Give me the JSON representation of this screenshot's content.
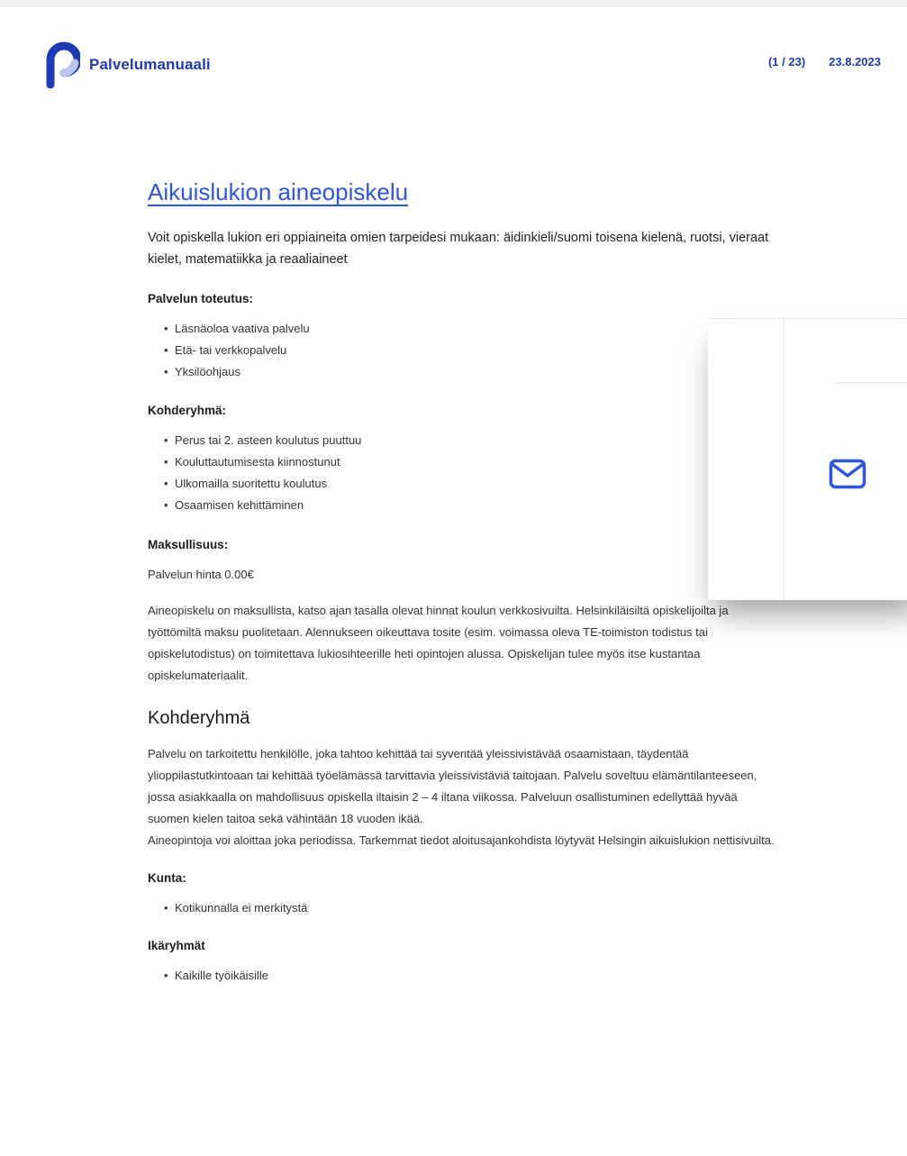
{
  "header": {
    "brand_name": "Palvelumanuaali",
    "page_indicator": "(1 / 23)",
    "date": "23.8.2023",
    "accent_color": "#1f3bb3",
    "logo_icon": "p-logo-icon"
  },
  "article": {
    "title": "Aikuislukion aineopiskelu",
    "intro": "Voit opiskella lukion eri oppiaineita omien tarpeidesi mukaan: äidinkieli/suomi toisena kielenä, ruotsi, vieraat kielet, matematiikka ja reaaliaineet",
    "toteutus": {
      "label": "Palvelun toteutus:",
      "items": [
        "Läsnäoloa vaativa palvelu",
        "Etä- tai verkkopalvelu",
        "Yksilöohjaus"
      ]
    },
    "kohderyhma_list": {
      "label": "Kohderyhmä:",
      "items": [
        "Perus tai 2. asteen koulutus puuttuu",
        "Kouluttautumisesta kiinnostunut",
        "Ulkomailla suoritettu koulutus",
        "Osaamisen kehittäminen"
      ]
    },
    "maksullisuus": {
      "label": "Maksullisuus:",
      "price": "Palvelun hinta 0.00€",
      "description": "Aineopiskelu on maksullista, katso ajan tasalla olevat hinnat koulun verkkosivuilta. Helsinkiläisiltä opiskelijoilta ja työttömiltä maksu puolitetaan. Alennukseen oikeuttava tosite (esim. voimassa oleva TE-toimiston todistus tai opiskelutodistus) on toimitettava lukiosihteerille heti opintojen alussa. Opiskelijan tulee myös itse kustantaa opiskelumateriaalit."
    },
    "kohderyhma_section": {
      "heading": "Kohderyhmä",
      "paragraph1": "Palvelu on tarkoitettu henkilölle, joka tahtoo kehittää tai syventää yleissivistävää osaamistaan, täydentää ylioppilastutkintoaan tai kehittää työelämässä tarvittavia yleissivistäviä taitojaan. Palvelu soveltuu elämäntilanteeseen, jossa asiakkaalla on mahdollisuus opiskella iltaisin 2 – 4 iltana viikossa. Palveluun osallistuminen edellyttää hyvää suomen kielen taitoa sekä vähintään 18 vuoden ikää.",
      "paragraph2": "Aineopintoja voi aloittaa joka periodissa. Tarkemmat tiedot aloitusajankohdista löytyvät Helsingin aikuislukion nettisivuilta."
    },
    "kunta": {
      "label": "Kunta:",
      "items": [
        "Kotikunnalla ei merkitystä"
      ]
    },
    "ikaryhmat": {
      "label": "Ikäryhmät",
      "items": [
        "Kaikille työikäisille"
      ]
    }
  },
  "floating_card": {
    "icon": "mail-icon"
  }
}
